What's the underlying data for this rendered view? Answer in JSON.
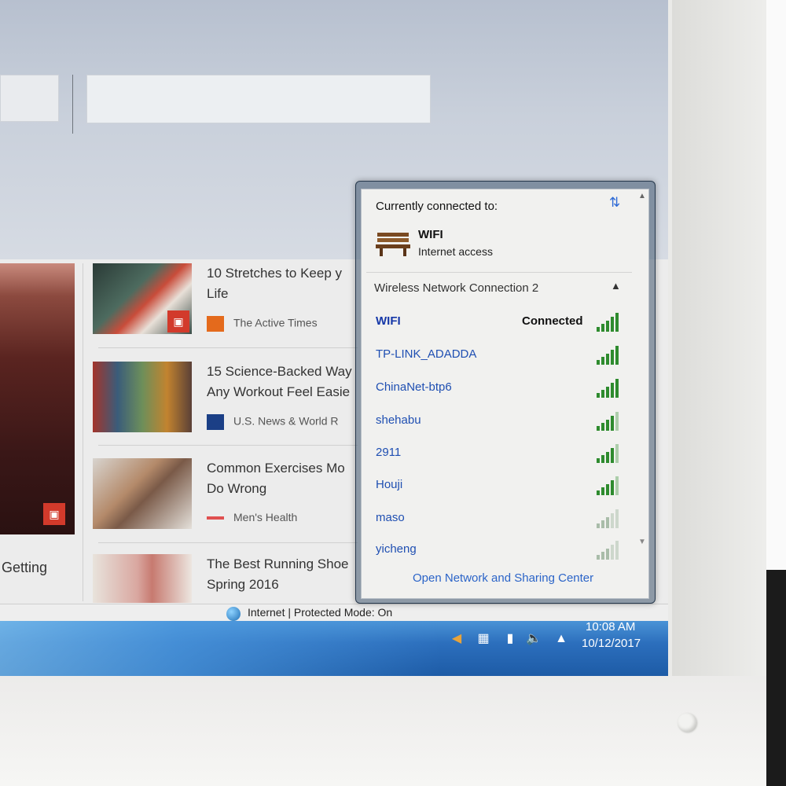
{
  "articles": [
    {
      "title_line1": "10 Stretches to Keep y",
      "title_line2": "Life",
      "source": "The Active Times"
    },
    {
      "title_line1": "15 Science-Backed Way",
      "title_line2": "Any Workout Feel Easie",
      "source": "U.S. News & World R"
    },
    {
      "title_line1": "Common Exercises Mo",
      "title_line2": "Do Wrong",
      "source": "Men's Health"
    },
    {
      "title_line1": "The Best Running Shoe",
      "title_line2": "Spring 2016",
      "source": ""
    }
  ],
  "left_caption": "Getting",
  "status_bar": {
    "text": "Internet | Protected Mode: On"
  },
  "clock": {
    "time": "10:08 AM",
    "date": "10/12/2017"
  },
  "network_popup": {
    "header": "Currently connected to:",
    "current_network": {
      "name": "WIFI",
      "status": "Internet access",
      "icon": "bench-icon"
    },
    "section_title": "Wireless Network Connection 2",
    "networks": [
      {
        "name": "WIFI",
        "status": "Connected",
        "signal_bars": 5
      },
      {
        "name": "TP-LINK_ADADDA",
        "status": "",
        "signal_bars": 5
      },
      {
        "name": "ChinaNet-btp6",
        "status": "",
        "signal_bars": 5
      },
      {
        "name": "shehabu",
        "status": "",
        "signal_bars": 4
      },
      {
        "name": "2911",
        "status": "",
        "signal_bars": 4
      },
      {
        "name": "Houji",
        "status": "",
        "signal_bars": 4
      },
      {
        "name": "maso",
        "status": "",
        "signal_bars": 3
      },
      {
        "name": "yicheng",
        "status": "",
        "signal_bars": 3
      }
    ],
    "footer_link": "Open Network and Sharing Center"
  },
  "colors": {
    "taskbar": "#2c6fbd",
    "link": "#1f4fb2",
    "signal": "#2e8b2e",
    "badge": "#d23a2b"
  }
}
